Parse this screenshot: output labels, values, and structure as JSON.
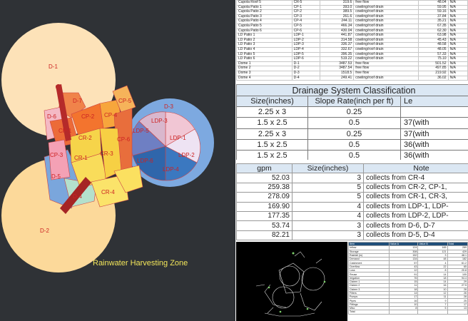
{
  "map": {
    "title": "Rainwater Harvesting Zone",
    "zones": {
      "d1": "D-1",
      "d2": "D-2",
      "d3": "D-3",
      "d4": "D-4",
      "d5": "D-5",
      "d6": "D-6",
      "d7": "D-7",
      "cp1": "CP-1",
      "cp2": "CP-2",
      "cp3": "CP-3",
      "cp4": "CP-4",
      "cp5": "CP-5",
      "cp6": "CP-6",
      "cr1": "CR-1",
      "cr2": "CR-2",
      "cr3": "CR-3",
      "cr4": "CR-4",
      "ldp1": "LDP-1",
      "ldp2": "LDP-2",
      "ldp3": "LDP-3",
      "ldp4": "LDP-4",
      "ldp5": "LDP-5",
      "ldp6": "LDP-6"
    },
    "colors": {
      "dome": "#fde2b8",
      "cupola": "#f07a3c",
      "roof": "#f6d44a",
      "patio": "#5b8fd0",
      "ground": "#2f3236"
    }
  },
  "sheet_top": {
    "rows": [
      [
        "Cupola Roof 5",
        "CR-5",
        "319.6",
        "free flow",
        "48.04",
        "N/A"
      ],
      [
        "Cupola Patio 1",
        "CP-1",
        "393.0",
        "cowling/roof drain",
        "59.95",
        "N/A"
      ],
      [
        "Cupola Patio 2",
        "CP-2",
        "389.5",
        "cowling/roof drain",
        "59.16",
        "N/A"
      ],
      [
        "Cupola Patio 3",
        "CP-3",
        "261.6",
        "cowling/roof drain",
        "37.84",
        "N/A"
      ],
      [
        "Cupola Patio 4",
        "CP-4",
        "244.11",
        "cowling/roof drain",
        "35.21",
        "N/A"
      ],
      [
        "Cupola Patio 5",
        "CP-5",
        "466.34",
        "cowling/roof drain",
        "67.35",
        "N/A"
      ],
      [
        "Cupola Patio 6",
        "CP-6",
        "430.04",
        "cowling/roof drain",
        "62.30",
        "N/A"
      ],
      [
        "LD Patio 1",
        "LDP-1",
        "441.87",
        "cowling/roof drain",
        "63.98",
        "N/A"
      ],
      [
        "LD Patio 2",
        "LDP-2",
        "314.58",
        "cowling/roof drain",
        "45.43",
        "N/A"
      ],
      [
        "LD Patio 3",
        "LDP-3",
        "336.37",
        "cowling/roof drain",
        "48.58",
        "N/A"
      ],
      [
        "LD Patio 4",
        "LDP-4",
        "332.67",
        "cowling/roof drain",
        "48.05",
        "N/A"
      ],
      [
        "LD Patio 5",
        "LDP-5",
        "396.35",
        "cowling/roof drain",
        "57.33",
        "N/A"
      ],
      [
        "LD Patio 6",
        "LDP-6",
        "519.22",
        "cowling/roof drain",
        "75.10",
        "N/A"
      ],
      [
        "Dome 1",
        "D-1",
        "3487.53",
        "free flow",
        "501.52",
        "N/A"
      ],
      [
        "Dome 2",
        "D-2",
        "3487.54",
        "free flow",
        "497.85",
        "N/A"
      ],
      [
        "Dome 3",
        "D-3",
        "1518.5",
        "free flow",
        "219.92",
        "N/A"
      ],
      [
        "Dome 4",
        "D-4",
        "249.41",
        "cowling/roof drain",
        "36.02",
        "N/A"
      ]
    ]
  },
  "drainage": {
    "title": "Drainage System Classification",
    "headers": [
      "Size(inches)",
      "Slope Rate(inch per ft)",
      "Le"
    ],
    "rows": [
      [
        "2.25 x 3",
        "0.25",
        ""
      ],
      [
        "1.5 x 2.5",
        "0.5",
        "37(with"
      ],
      [
        "2.25 x 3",
        "0.25",
        "37(with"
      ],
      [
        "1.5 x 2.5",
        "0.5",
        "36(with"
      ],
      [
        "1.5 x 2.5",
        "0.5",
        "36(with"
      ]
    ]
  },
  "gpm_table": {
    "headers": [
      "gpm",
      "Size(inches)",
      "Note"
    ],
    "rows": [
      [
        "52.03",
        "3",
        "collects from CR-4"
      ],
      [
        "259.38",
        "5",
        "collects from CR-2, CP-1,"
      ],
      [
        "278.09",
        "5",
        "collects from CR-1, CR-3,"
      ],
      [
        "169.90",
        "4",
        "collects from LDP-1, LDP-"
      ],
      [
        "177.35",
        "4",
        "collects from LDP-2, LDP-"
      ],
      [
        "53.74",
        "3",
        "collects from D-6, D-7"
      ],
      [
        "82.21",
        "3",
        "collects from D-5, D-4"
      ]
    ]
  },
  "small_sheet": {
    "headers": [
      "Item",
      "Value A",
      "Value B",
      "Total"
    ],
    "rows": [
      [
        "Inflow",
        "124",
        "165",
        "289"
      ],
      [
        "Storage",
        "308",
        "121",
        "429"
      ],
      [
        "Rainfall (in)",
        "152",
        "3",
        "48.1"
      ],
      [
        "Demand",
        "134",
        "48",
        "182"
      ],
      [
        "Catchment",
        "57",
        "4",
        "61.2"
      ],
      [
        "Overflow",
        "43",
        "22",
        "65"
      ],
      [
        "Loss",
        "12",
        "8",
        "20.8"
      ],
      [
        "Reuse",
        "91",
        "14",
        "105"
      ],
      [
        "Irrigation",
        "76",
        "18",
        "94.4"
      ],
      [
        "Cistern 1",
        "15",
        "14",
        "29"
      ],
      [
        "Cistern 2",
        "11",
        "16",
        "27.5"
      ],
      [
        "Cistern 3",
        "18",
        "10",
        "28"
      ],
      [
        "Filters",
        "14",
        "12",
        "26"
      ],
      [
        "Pumps",
        "17",
        "11",
        "28"
      ],
      [
        "Pipes",
        "16",
        "9",
        "25"
      ],
      [
        "Fittings",
        "10",
        "7",
        "17"
      ],
      [
        "Misc",
        "8",
        "5",
        "13"
      ],
      [
        "Total",
        "",
        "",
        ""
      ]
    ]
  }
}
